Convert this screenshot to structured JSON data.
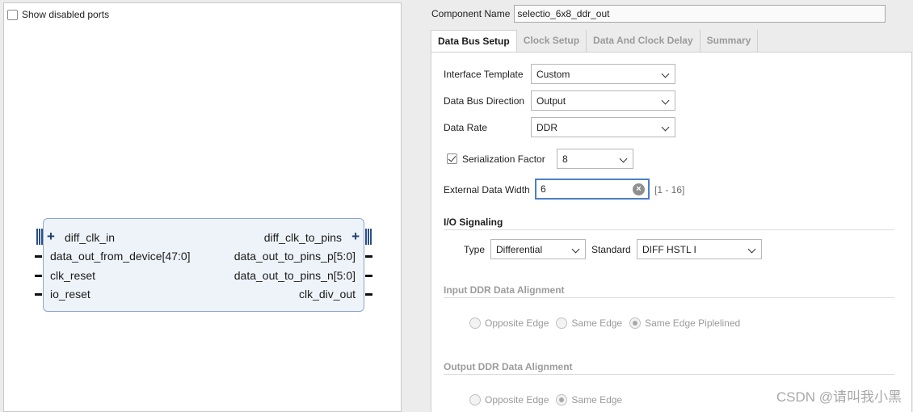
{
  "left": {
    "show_disabled_ports": {
      "label": "Show disabled ports",
      "checked": false
    },
    "block": {
      "left_ports": [
        "diff_clk_in",
        "data_out_from_device[47:0]",
        "clk_reset",
        "io_reset"
      ],
      "right_ports": [
        "diff_clk_to_pins",
        "data_out_to_pins_p[5:0]",
        "data_out_to_pins_n[5:0]",
        "clk_div_out"
      ]
    }
  },
  "right": {
    "component_name": {
      "label": "Component Name",
      "value": "selectio_6x8_ddr_out"
    },
    "tabs": [
      {
        "label": "Data Bus Setup",
        "active": true
      },
      {
        "label": "Clock Setup",
        "active": false
      },
      {
        "label": "Data And Clock Delay",
        "active": false
      },
      {
        "label": "Summary",
        "active": false
      }
    ],
    "interface_template": {
      "label": "Interface Template",
      "value": "Custom"
    },
    "data_bus_direction": {
      "label": "Data Bus Direction",
      "value": "Output"
    },
    "data_rate": {
      "label": "Data Rate",
      "value": "DDR"
    },
    "serialization_factor": {
      "label": "Serialization Factor",
      "checked": true,
      "value": "8"
    },
    "external_data_width": {
      "label": "External Data Width",
      "value": "6",
      "range": "[1 - 16]"
    },
    "io_signaling": {
      "title": "I/O Signaling",
      "type_label": "Type",
      "type_value": "Differential",
      "standard_label": "Standard",
      "standard_value": "DIFF HSTL I"
    },
    "input_ddr": {
      "title": "Input DDR Data Alignment",
      "options": [
        "Opposite Edge",
        "Same Edge",
        "Same Edge Piplelined"
      ],
      "selected": "Same Edge Piplelined"
    },
    "output_ddr": {
      "title": "Output DDR Data Alignment",
      "options": [
        "Opposite Edge",
        "Same Edge"
      ],
      "selected": "Same Edge"
    }
  },
  "watermark": "CSDN @请叫我小黑",
  "colors": {
    "accent": "#4a7fc8",
    "block_fill": "#eef3f9",
    "block_border": "#8ca6c8"
  }
}
